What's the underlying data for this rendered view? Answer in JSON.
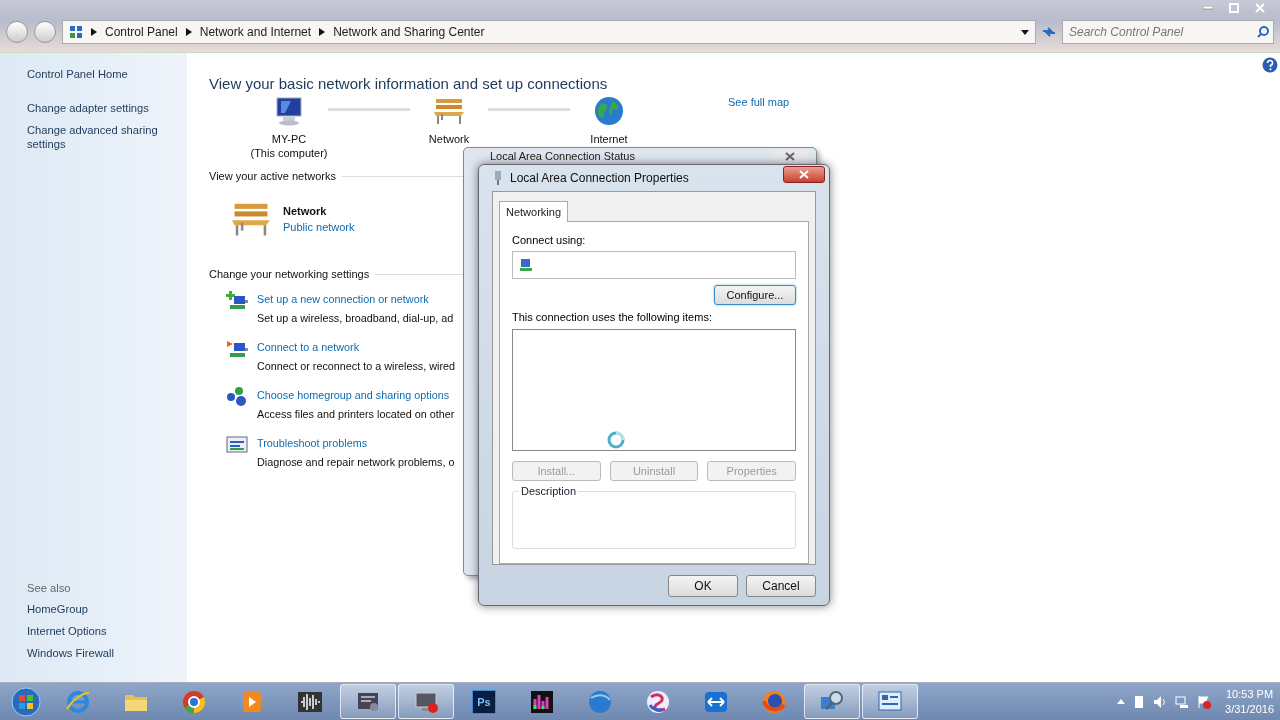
{
  "address_bar": {
    "breadcrumbs": [
      "Control Panel",
      "Network and Internet",
      "Network and Sharing Center"
    ]
  },
  "search": {
    "placeholder": "Search Control Panel"
  },
  "sidebar": {
    "links": [
      "Control Panel Home",
      "Change adapter settings",
      "Change advanced sharing settings"
    ],
    "see_also_title": "See also",
    "see_also": [
      "HomeGroup",
      "Internet Options",
      "Windows Firewall"
    ]
  },
  "main": {
    "heading": "View your basic network information and set up connections",
    "map": [
      {
        "kind": "computer",
        "label": "MY-PC",
        "sublabel": "(This computer)"
      },
      {
        "kind": "bench",
        "label": "Network"
      },
      {
        "kind": "globe",
        "label": "Internet"
      }
    ],
    "see_full_map": "See full map",
    "active_networks_title": "View your active networks",
    "active_network": {
      "name": "Network",
      "type": "Public network"
    },
    "settings_title": "Change your networking settings",
    "tasks": [
      {
        "kind": "new-connection",
        "title": "Set up a new connection or network",
        "description": "Set up a wireless, broadband, dial-up, ad"
      },
      {
        "kind": "connect",
        "title": "Connect to a network",
        "description": "Connect or reconnect to a wireless, wired"
      },
      {
        "kind": "homegroup",
        "title": "Choose homegroup and sharing options",
        "description": "Access files and printers located on other"
      },
      {
        "kind": "troubleshoot",
        "title": "Troubleshoot problems",
        "description": "Diagnose and repair network problems, o"
      }
    ]
  },
  "status_dialog": {
    "title": "Local Area Connection Status"
  },
  "properties_dialog": {
    "title": "Local Area Connection Properties",
    "tabs": [
      {
        "label": "Networking",
        "selected": true
      }
    ],
    "connect_using_label": "Connect using:",
    "configure": "Configure...",
    "items_label": "This connection uses the following items:",
    "item_buttons": [
      {
        "label": "Install...",
        "disabled": true
      },
      {
        "label": "Uninstall",
        "disabled": true
      },
      {
        "label": "Properties",
        "disabled": true
      }
    ],
    "description_label": "Description",
    "buttons": [
      "OK",
      "Cancel"
    ]
  },
  "taskbar": {
    "items": [
      {
        "kind": "ie",
        "selected": false
      },
      {
        "kind": "folder",
        "selected": false
      },
      {
        "kind": "chrome",
        "selected": false
      },
      {
        "kind": "media",
        "selected": false
      },
      {
        "kind": "audio",
        "selected": false
      },
      {
        "kind": "app",
        "selected": true
      },
      {
        "kind": "recorder",
        "selected": true
      },
      {
        "kind": "tile",
        "label": "Ps",
        "selected": false
      },
      {
        "kind": "bars",
        "selected": false
      },
      {
        "kind": "circle",
        "selected": false
      },
      {
        "kind": "swirl",
        "selected": false
      },
      {
        "kind": "teamviewer",
        "selected": false
      },
      {
        "kind": "firefox",
        "selected": false
      },
      {
        "kind": "network-tool",
        "selected": true
      },
      {
        "kind": "control-panel",
        "selected": true
      }
    ],
    "clock": {
      "time": "10:53 PM",
      "date": "3/31/2016"
    }
  }
}
